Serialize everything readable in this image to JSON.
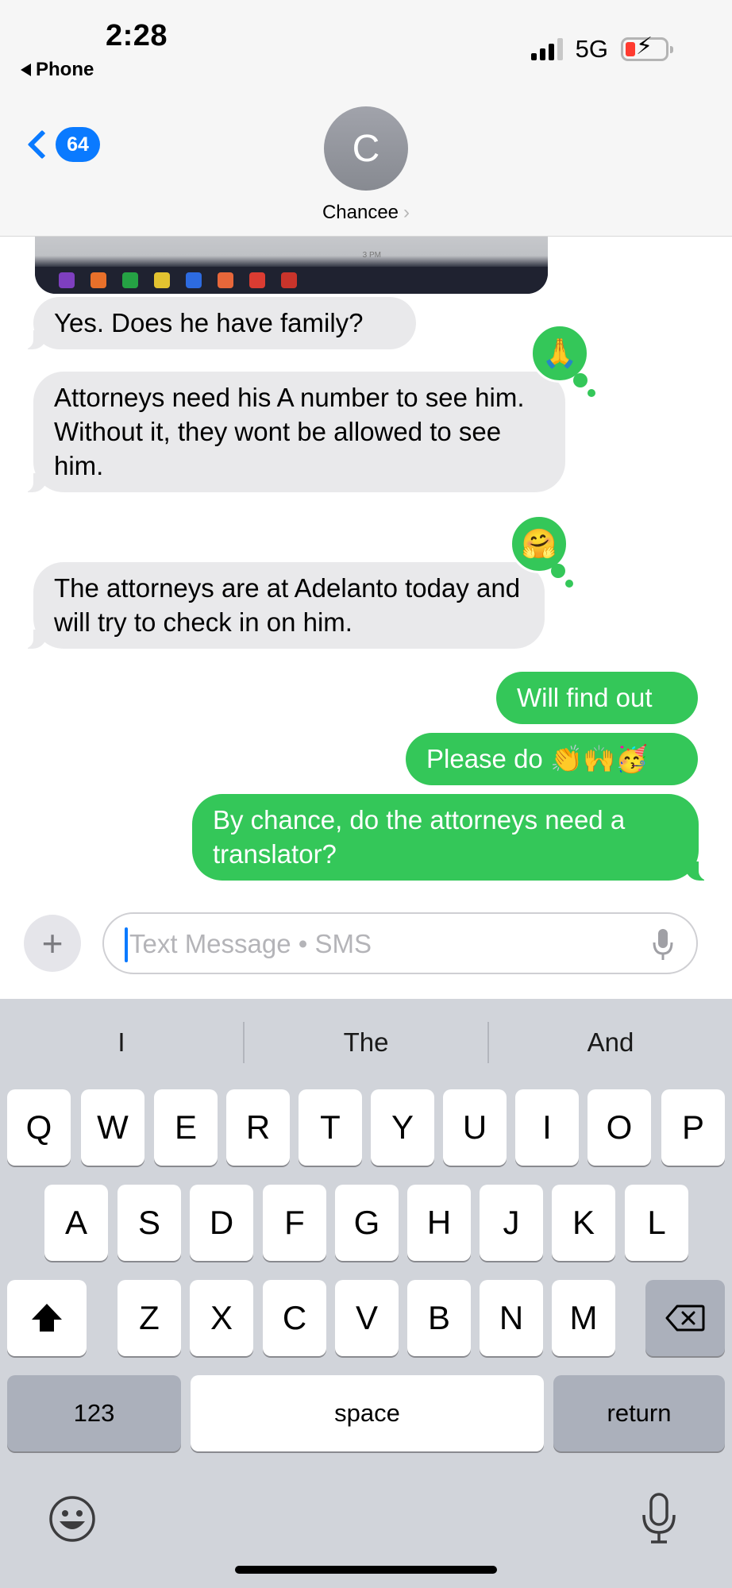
{
  "status_bar": {
    "time": "2:28",
    "back_app": "Phone",
    "network": "5G",
    "battery_level": "low, charging"
  },
  "header": {
    "back_count": "64",
    "avatar_initial": "C",
    "contact_name": "Chancee",
    "contact_chevron": "›"
  },
  "photo": {
    "clock_text": "3 PM"
  },
  "messages": [
    {
      "direction": "incoming",
      "text": "Yes.  Does he have family?"
    },
    {
      "direction": "incoming",
      "text": "Attorneys need his A number to see him.  Without it, they wont be allowed to see him.",
      "tapback": "🙏"
    },
    {
      "direction": "incoming",
      "text": "The attorneys are at Adelanto today and will try to check in on him.",
      "tapback": "🤗"
    },
    {
      "direction": "outgoing",
      "text": "Will find out"
    },
    {
      "direction": "outgoing",
      "text": "Please do 👏🙌🥳"
    },
    {
      "direction": "outgoing",
      "text": "By chance, do the attorneys need a translator?"
    }
  ],
  "input": {
    "placeholder": "Text Message • SMS",
    "value": ""
  },
  "keyboard": {
    "suggestions": [
      "I",
      "The",
      "And"
    ],
    "row1": [
      "Q",
      "W",
      "E",
      "R",
      "T",
      "Y",
      "U",
      "I",
      "O",
      "P"
    ],
    "row2": [
      "A",
      "S",
      "D",
      "F",
      "G",
      "H",
      "J",
      "K",
      "L"
    ],
    "row3": [
      "Z",
      "X",
      "C",
      "V",
      "B",
      "N",
      "M"
    ],
    "numbers_label": "123",
    "space_label": "space",
    "return_label": "return"
  },
  "colors": {
    "accent_blue": "#0a7aff",
    "outgoing_green": "#34c759",
    "incoming_gray": "#e9e9eb",
    "keyboard_bg": "#d1d4da"
  },
  "icons": [
    "phone-back-icon",
    "signal-icon",
    "battery-icon",
    "chevron-left-icon",
    "plus-icon",
    "microphone-icon",
    "shift-icon",
    "delete-icon",
    "emoji-icon",
    "dictation-icon"
  ]
}
